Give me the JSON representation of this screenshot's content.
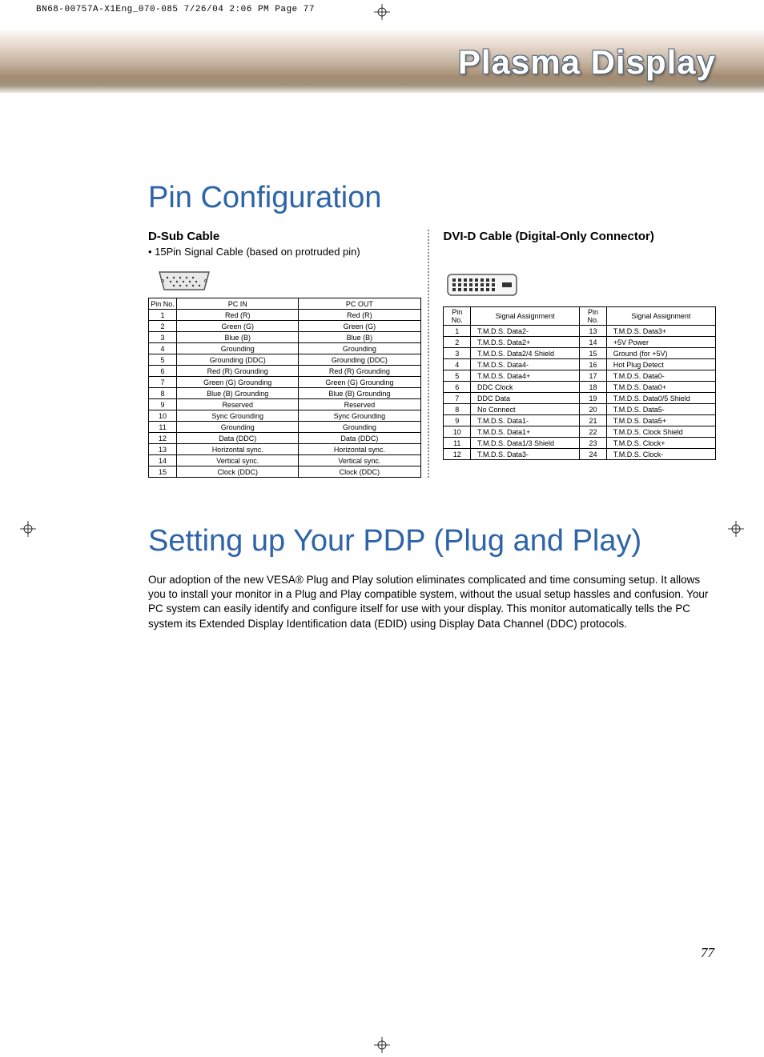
{
  "print_header": "BN68-00757A-X1Eng_070-085  7/26/04  2:06 PM  Page 77",
  "banner_title": "Plasma Display",
  "section1": {
    "title": "Pin Configuration",
    "left": {
      "heading": "D-Sub Cable",
      "note": "• 15Pin Signal Cable (based on protruded pin)",
      "headers": [
        "Pin No.",
        "PC IN",
        "PC OUT"
      ],
      "rows": [
        [
          "1",
          "Red (R)",
          "Red (R)"
        ],
        [
          "2",
          "Green (G)",
          "Green (G)"
        ],
        [
          "3",
          "Blue (B)",
          "Blue (B)"
        ],
        [
          "4",
          "Grounding",
          "Grounding"
        ],
        [
          "5",
          "Grounding (DDC)",
          "Grounding (DDC)"
        ],
        [
          "6",
          "Red (R) Grounding",
          "Red (R) Grounding"
        ],
        [
          "7",
          "Green (G) Grounding",
          "Green (G) Grounding"
        ],
        [
          "8",
          "Blue (B) Grounding",
          "Blue (B) Grounding"
        ],
        [
          "9",
          "Reserved",
          "Reserved"
        ],
        [
          "10",
          "Sync Grounding",
          "Sync Grounding"
        ],
        [
          "11",
          "Grounding",
          "Grounding"
        ],
        [
          "12",
          "Data (DDC)",
          "Data (DDC)"
        ],
        [
          "13",
          "Horizontal sync.",
          "Horizontal sync."
        ],
        [
          "14",
          "Vertical sync.",
          "Vertical sync."
        ],
        [
          "15",
          "Clock (DDC)",
          "Clock (DDC)"
        ]
      ]
    },
    "right": {
      "heading": "DVI-D Cable (Digital-Only Connector)",
      "headers": [
        "Pin No.",
        "Signal Assignment",
        "Pin No.",
        "Signal Assignment"
      ],
      "rows": [
        [
          "1",
          "T.M.D.S. Data2-",
          "13",
          "T.M.D.S. Data3+"
        ],
        [
          "2",
          "T.M.D.S. Data2+",
          "14",
          "+5V Power"
        ],
        [
          "3",
          "T.M.D.S. Data2/4 Shield",
          "15",
          "Ground (for +5V)"
        ],
        [
          "4",
          "T.M.D.S. Data4-",
          "16",
          "Hot Plug Detect"
        ],
        [
          "5",
          "T.M.D.S. Data4+",
          "17",
          "T.M.D.S. Data0-"
        ],
        [
          "6",
          "DDC  Clock",
          "18",
          "T.M.D.S. Data0+"
        ],
        [
          "7",
          "DDC Data",
          "19",
          "T.M.D.S. Data0/5 Shield"
        ],
        [
          "8",
          "No Connect",
          "20",
          "T.M.D.S. Data5-"
        ],
        [
          "9",
          "T.M.D.S. Data1-",
          "21",
          "T.M.D.S. Data5+"
        ],
        [
          "10",
          "T.M.D.S. Data1+",
          "22",
          "T.M.D.S. Clock Shield"
        ],
        [
          "11",
          "T.M.D.S. Data1/3 Shield",
          "23",
          "T.M.D.S. Clock+"
        ],
        [
          "12",
          "T.M.D.S. Data3-",
          "24",
          "T.M.D.S. Clock-"
        ]
      ]
    }
  },
  "section2": {
    "title": "Setting up Your PDP (Plug and Play)",
    "body": "Our adoption of the new VESA® Plug and Play solution eliminates complicated and time consuming setup. It allows you to install your monitor in a Plug and Play compatible system, without the usual setup hassles and confusion. Your PC system can easily identify and configure itself for use with your display. This monitor automatically tells the PC system its Extended Display Identification data (EDID) using Display Data Channel (DDC) protocols."
  },
  "page_number": "77"
}
